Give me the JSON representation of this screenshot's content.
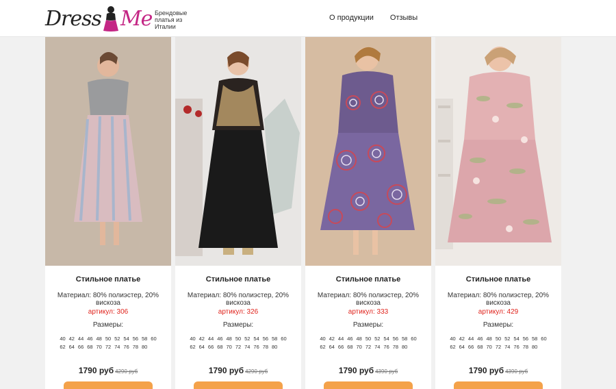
{
  "header": {
    "logo_left": "Dress",
    "logo_right": "Me",
    "tagline": "Брендовые платья из Италии",
    "nav": [
      "О продукции",
      "Отзывы"
    ]
  },
  "products": [
    {
      "title": "Стильное платье",
      "material": "Материал: 80% полиэстер, 20% вискоза",
      "article": "артикул: 306",
      "sizes_label": "Размеры:",
      "sizes_row1": [
        "40",
        "42",
        "44",
        "46",
        "48",
        "50",
        "52",
        "54",
        "56",
        "58",
        "60"
      ],
      "sizes_row2": [
        "62",
        "64",
        "66",
        "68",
        "70",
        "72",
        "74",
        "76",
        "78",
        "80"
      ],
      "price": "1790 руб",
      "old_price": "4290 руб",
      "image_colors": {
        "bg": "#c7b8a8",
        "dress_top": "#9a9b9d",
        "dress_bottom": "#d9bcc0"
      }
    },
    {
      "title": "Стильное платье",
      "material": "Материал: 80% полиэстер, 20% вискоза",
      "article": "артикул: 326",
      "sizes_label": "Размеры:",
      "sizes_row1": [
        "40",
        "42",
        "44",
        "46",
        "48",
        "50",
        "52",
        "54",
        "56",
        "58",
        "60"
      ],
      "sizes_row2": [
        "62",
        "64",
        "66",
        "68",
        "70",
        "72",
        "74",
        "76",
        "78",
        "80"
      ],
      "price": "1790 руб",
      "old_price": "4290 руб",
      "image_colors": {
        "bg": "#e8e6e4",
        "dress_top": "#2a2320",
        "dress_bottom": "#1a1a1a"
      }
    },
    {
      "title": "Стильное платье",
      "material": "Материал: 80% полиэстер, 20% вискоза",
      "article": "артикул: 333",
      "sizes_label": "Размеры:",
      "sizes_row1": [
        "40",
        "42",
        "44",
        "46",
        "48",
        "50",
        "52",
        "54",
        "56",
        "58",
        "60"
      ],
      "sizes_row2": [
        "62",
        "64",
        "66",
        "68",
        "70",
        "72",
        "74",
        "76",
        "78",
        "80"
      ],
      "price": "1790 руб",
      "old_price": "4390 руб",
      "image_colors": {
        "bg": "#d6bca2",
        "dress_top": "#6d5b8e",
        "dress_bottom": "#7a67a0"
      }
    },
    {
      "title": "Стильное платье",
      "material": "Материал: 80% полиэстер, 20% вискоза",
      "article": "артикул: 429",
      "sizes_label": "Размеры:",
      "sizes_row1": [
        "40",
        "42",
        "44",
        "46",
        "48",
        "50",
        "52",
        "54",
        "56",
        "58",
        "60"
      ],
      "sizes_row2": [
        "62",
        "64",
        "66",
        "68",
        "70",
        "72",
        "74",
        "76",
        "78",
        "80"
      ],
      "price": "1790 руб",
      "old_price": "4390 руб",
      "image_colors": {
        "bg": "#eeeae6",
        "dress_top": "#e3b1b3",
        "dress_bottom": "#dca6ab"
      }
    }
  ],
  "colors": {
    "accent": "#c42685",
    "article": "#e0231c",
    "button": "#f4a24a"
  }
}
